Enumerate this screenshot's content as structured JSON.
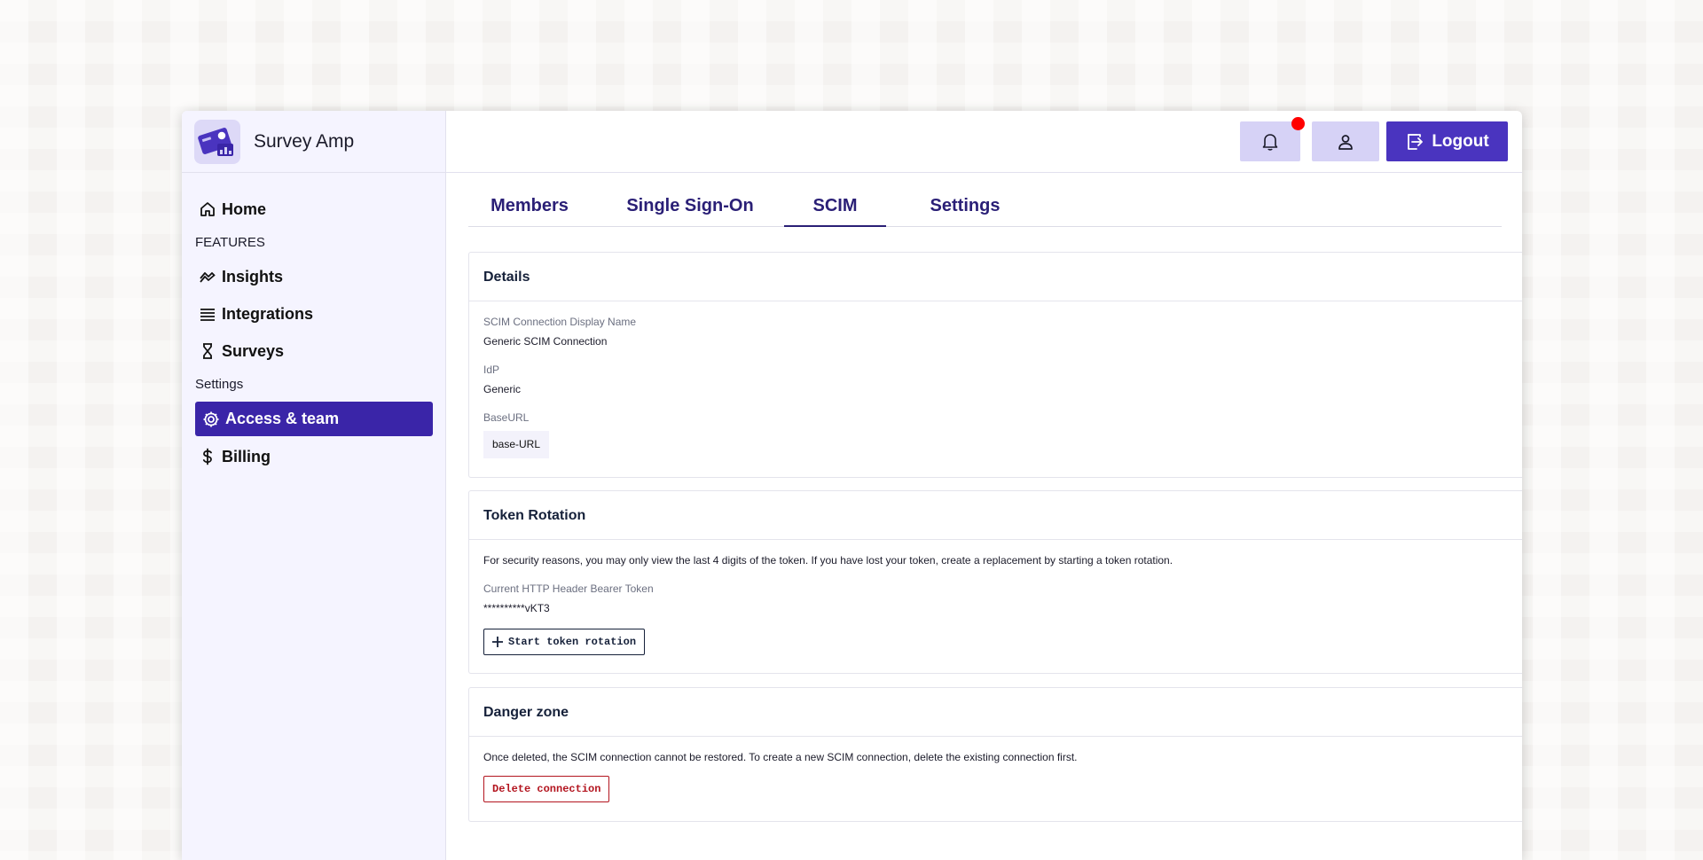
{
  "app": {
    "name": "Survey Amp"
  },
  "header": {
    "logout_label": "Logout"
  },
  "sidebar": {
    "home": "Home",
    "features_heading": "FEATURES",
    "insights": "Insights",
    "integrations": "Integrations",
    "surveys": "Surveys",
    "settings_heading": "Settings",
    "access_team": "Access & team",
    "billing": "Billing"
  },
  "tabs": [
    "Members",
    "Single Sign-On",
    "SCIM",
    "Settings"
  ],
  "details": {
    "title": "Details",
    "display_name_label": "SCIM Connection Display Name",
    "display_name_value": "Generic SCIM Connection",
    "idp_label": "IdP",
    "idp_value": "Generic",
    "baseurl_label": "BaseURL",
    "baseurl_value": "base-URL"
  },
  "token": {
    "title": "Token Rotation",
    "description": "For security reasons, you may only view the last 4 digits of the token. If you have lost your token, create a replacement by starting a token rotation.",
    "token_label": "Current HTTP Header Bearer Token",
    "token_value": "**********vKT3",
    "rotate_button": "Start token rotation"
  },
  "danger": {
    "title": "Danger zone",
    "description": "Once deleted, the SCIM connection cannot be restored. To create a new SCIM connection, delete the existing connection first.",
    "delete_button": "Delete connection"
  },
  "colors": {
    "accent": "#4a34bf",
    "active_nav": "#3a25a8",
    "danger": "#b3151f",
    "notification": "#ff0000"
  },
  "icons": {
    "home": "home-icon",
    "insights": "trend-icon",
    "integrations": "stack-icon",
    "surveys": "hourglass-icon",
    "access_team": "gear-icon",
    "billing": "dollar-icon",
    "notifications": "bell-icon",
    "profile": "user-icon",
    "logout": "logout-icon",
    "rotate": "plus-icon"
  }
}
